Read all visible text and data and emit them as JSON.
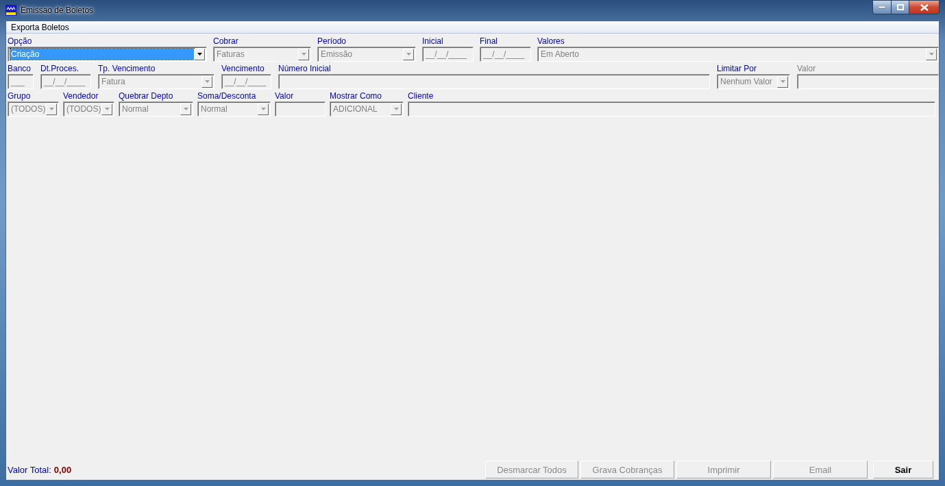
{
  "window": {
    "title": "Emissao de Boletos"
  },
  "menu": [
    {
      "label": "Exporta Boletos"
    }
  ],
  "form": {
    "lines": [
      {
        "fields": [
          {
            "label": "Opção",
            "label_disabled": false,
            "kind": "combo",
            "value": "Criação",
            "disabled": false,
            "focused": true
          },
          {
            "label": "Cobrar",
            "label_disabled": false,
            "kind": "combo",
            "value": "Faturas",
            "disabled": true,
            "focused": false
          },
          {
            "label": "Período",
            "label_disabled": false,
            "kind": "combo",
            "value": "Emissão",
            "disabled": true,
            "focused": false
          },
          {
            "label": "Inicial",
            "label_disabled": false,
            "kind": "input",
            "value": "__/__/____",
            "disabled": true,
            "focused": false
          },
          {
            "label": "Final",
            "label_disabled": false,
            "kind": "input",
            "value": "__/__/____",
            "disabled": true,
            "focused": false
          },
          {
            "label": "Valores",
            "label_disabled": false,
            "kind": "combo",
            "value": "Em Aberto",
            "disabled": true,
            "focused": false
          }
        ]
      },
      {
        "fields": [
          {
            "label": "Banco",
            "label_disabled": false,
            "kind": "input",
            "value": "___",
            "disabled": true,
            "focused": false
          },
          {
            "label": "Dt.Proces.",
            "label_disabled": false,
            "kind": "input",
            "value": "__/__/____",
            "disabled": true,
            "focused": false
          },
          {
            "label": "Tp. Vencimento",
            "label_disabled": false,
            "kind": "combo",
            "value": "Fatura",
            "disabled": true,
            "focused": false
          },
          {
            "label": "Vencimento",
            "label_disabled": false,
            "kind": "input",
            "value": "__/__/____",
            "disabled": true,
            "focused": false
          },
          {
            "label": "Número Inicial",
            "label_disabled": false,
            "kind": "input",
            "disabled": true,
            "focused": false
          },
          {
            "label": "Limitar Por",
            "label_disabled": false,
            "kind": "combo",
            "value": "Nenhum Valor",
            "disabled": true,
            "focused": false
          },
          {
            "label": "Valor",
            "label_disabled": true,
            "kind": "input",
            "disabled": true,
            "focused": false
          }
        ]
      },
      {
        "fields": [
          {
            "label": "Grupo",
            "label_disabled": false,
            "kind": "combo",
            "value": "(TODOS)",
            "disabled": true,
            "focused": false
          },
          {
            "label": "Vendedor",
            "label_disabled": false,
            "kind": "combo",
            "value": "(TODOS)",
            "disabled": true,
            "focused": false
          },
          {
            "label": "Quebrar Depto",
            "label_disabled": false,
            "kind": "combo",
            "value": "Normal",
            "disabled": true,
            "focused": false
          },
          {
            "label": "Soma/Desconta",
            "label_disabled": false,
            "kind": "combo",
            "value": "Normal",
            "disabled": true,
            "focused": false
          },
          {
            "label": "Valor",
            "label_disabled": false,
            "kind": "input",
            "disabled": true,
            "focused": false
          },
          {
            "label": "Mostrar Como",
            "label_disabled": false,
            "kind": "combo",
            "value": "ADICIONAL",
            "disabled": true,
            "focused": false
          },
          {
            "label": "Cliente",
            "label_disabled": false,
            "kind": "input",
            "disabled": true,
            "focused": false
          }
        ]
      }
    ]
  },
  "footer": {
    "total_label": "Valor Total:",
    "total_value": "0,00",
    "buttons": [
      {
        "label": "Desmarcar Todos",
        "disabled": true,
        "default": false
      },
      {
        "label": "Grava Cobranças",
        "disabled": true,
        "default": false
      },
      {
        "label": "Imprimir",
        "disabled": true,
        "default": false
      },
      {
        "label": "Email",
        "disabled": true,
        "default": false
      },
      {
        "label": "Sair",
        "disabled": false,
        "default": true
      }
    ]
  }
}
